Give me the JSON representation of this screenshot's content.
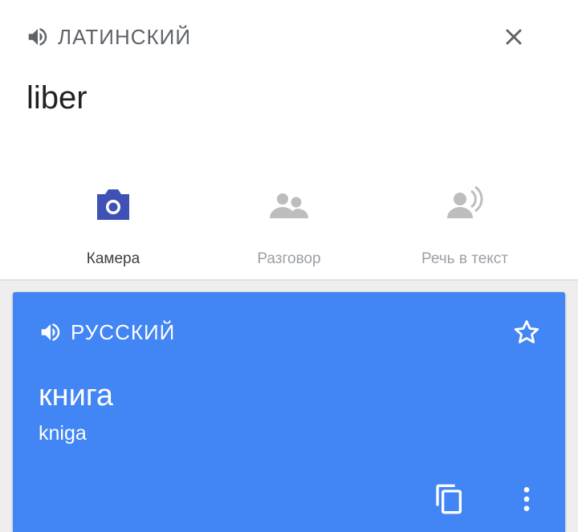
{
  "source": {
    "language": "ЛАТИНСКИЙ",
    "text": "liber",
    "speaker_icon": "volume-icon",
    "close_icon": "close-icon"
  },
  "tools": [
    {
      "label": "Камера",
      "icon": "camera-icon",
      "active": true
    },
    {
      "label": "Разговор",
      "icon": "conversation-icon",
      "active": false
    },
    {
      "label": "Речь в текст",
      "icon": "speech-to-text-icon",
      "active": false
    }
  ],
  "result": {
    "language": "РУССКИЙ",
    "text": "книга",
    "transliteration": "kniga",
    "star_icon": "star-outline-icon",
    "copy_icon": "copy-icon",
    "more_icon": "more-vertical-icon"
  },
  "colors": {
    "accent": "#4285f4",
    "active_icon": "#3f51b5",
    "inactive_icon": "#bdbdbd",
    "source_text": "#202124",
    "lang_label": "#5f6368"
  }
}
